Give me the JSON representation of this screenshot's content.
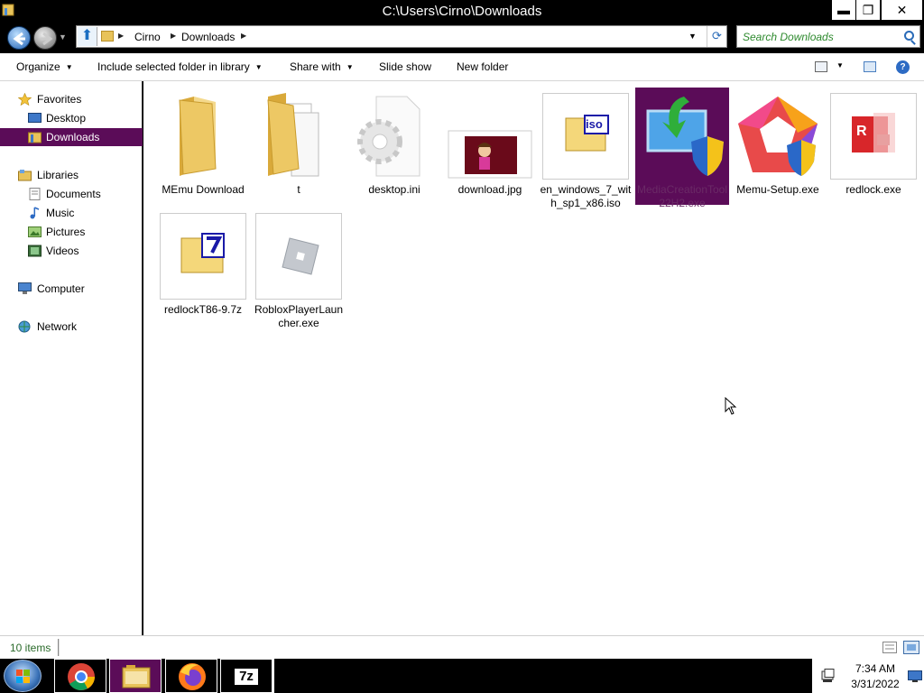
{
  "window": {
    "title": "C:\\Users\\Cirno\\Downloads",
    "min_glyph": "▬",
    "max_glyph": "❐",
    "close_glyph": "✕"
  },
  "address": {
    "crumbs": [
      "Cirno",
      "Downloads"
    ],
    "search_placeholder": "Search Downloads"
  },
  "toolbar": {
    "organize": "Organize",
    "include_library": "Include selected folder in library",
    "share_with": "Share with",
    "slide_show": "Slide show",
    "new_folder": "New folder",
    "help_glyph": "?"
  },
  "sidebar": {
    "favorites": "Favorites",
    "desktop": "Desktop",
    "downloads": "Downloads",
    "libraries": "Libraries",
    "documents": "Documents",
    "music": "Music",
    "pictures": "Pictures",
    "videos": "Videos",
    "computer": "Computer",
    "network": "Network"
  },
  "files": [
    {
      "name": "MEmu Download",
      "icon": "folder-icon"
    },
    {
      "name": "t",
      "icon": "folder-open-icon"
    },
    {
      "name": "desktop.ini",
      "icon": "settings-file-icon"
    },
    {
      "name": "download.jpg",
      "icon": "image-thumbnail"
    },
    {
      "name": "en_windows_7_with_sp1_x86.iso",
      "icon": "iso-icon"
    },
    {
      "name": "MediaCreationTool22H2.exe",
      "icon": "media-creation-icon"
    },
    {
      "name": "Memu-Setup.exe",
      "icon": "memu-icon"
    },
    {
      "name": "redlock.exe",
      "icon": "redlock-icon"
    },
    {
      "name": "redlockT86-9.7z",
      "icon": "7z-icon"
    },
    {
      "name": "RobloxPlayerLauncher.exe",
      "icon": "roblox-icon"
    }
  ],
  "status": {
    "count": "10 items"
  },
  "taskbar": {
    "time": "7:34 AM",
    "date": "3/31/2022",
    "sevenzip_label": "7z"
  },
  "colors": {
    "selection": "#5b0c58",
    "accent": "#2d6bc4"
  }
}
